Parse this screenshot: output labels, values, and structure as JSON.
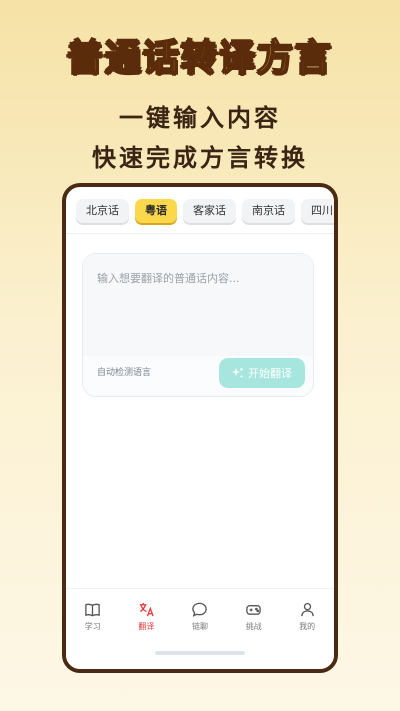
{
  "header": {
    "title": "普通话转译方言",
    "subtitle_line1": "一键输入内容",
    "subtitle_line2": "快速完成方言转换"
  },
  "dialect_tabs": [
    {
      "label": "北京话",
      "active": false
    },
    {
      "label": "粤语",
      "active": true
    },
    {
      "label": "客家话",
      "active": false
    },
    {
      "label": "南京话",
      "active": false
    },
    {
      "label": "四川",
      "active": false
    }
  ],
  "input_card": {
    "placeholder": "输入想要翻译的普通话内容...",
    "detect_label": "自动检测语言",
    "translate_button": "开始翻译"
  },
  "bottom_nav": [
    {
      "label": "学习",
      "icon": "book-icon",
      "active": false
    },
    {
      "label": "翻译",
      "icon": "translate-icon",
      "active": true
    },
    {
      "label": "链聊",
      "icon": "chat-bubble-icon",
      "active": false
    },
    {
      "label": "挑战",
      "icon": "gamepad-icon",
      "active": false
    },
    {
      "label": "我的",
      "icon": "person-icon",
      "active": false
    }
  ],
  "colors": {
    "accent_yellow": "#fbd84b",
    "button_teal": "#a7e6de",
    "active_nav_red": "#e23c3c",
    "frame_brown": "#4a2a12"
  }
}
